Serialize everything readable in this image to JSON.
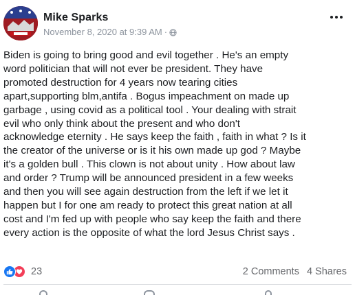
{
  "post": {
    "author": "Mike Sparks",
    "timestamp": "November 8, 2020 at 9:39 AM",
    "separator": "·",
    "privacy_icon": "globe-icon",
    "more_icon": "more-options-icon",
    "body_lines": [
      "Biden is going to bring good and evil together . He's an empty",
      "word politician that will not ever be president. They have",
      "promoted destruction for 4 years now tearing cities",
      "apart,supporting blm,antifa . Bogus impeachment on made up",
      "garbage , using covid as a political tool . Your dealing with strait",
      "evil who only think about the present and who don't",
      "acknowledge eternity . He says keep the faith , faith in what ? Is it",
      "the creator of the universe or is it his own made up god ? Maybe",
      "it's a golden bull . This clown is not about unity . How about law",
      "and order ? Trump will be announced president in a few weeks",
      "and then you will see again destruction from the left if we let it",
      "happen but I for one am ready to protect this great nation at all",
      "cost and I'm fed up with people who say keep the faith and there",
      "every action is the opposite of what the lord Jesus Christ says ."
    ],
    "reactions": {
      "icons": [
        "like-icon",
        "love-icon"
      ],
      "count": "23"
    },
    "comments": "2 Comments",
    "shares": "4 Shares"
  },
  "colors": {
    "text": "#1c1e21",
    "secondary": "#65676b",
    "like": "#1877f2",
    "love": "#f33e58",
    "avatar_bg": "#9e1b22"
  }
}
